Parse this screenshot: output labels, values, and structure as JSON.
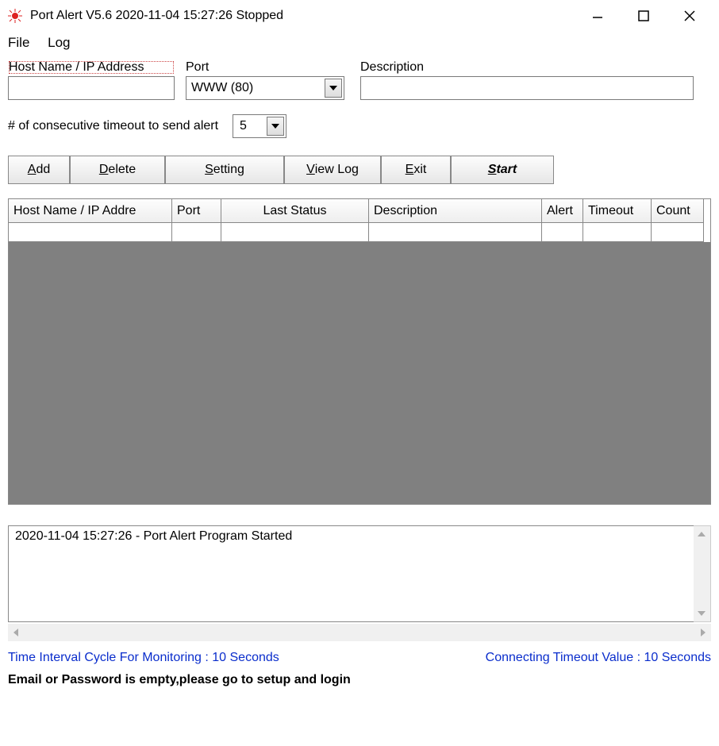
{
  "window": {
    "title": "Port Alert V5.6 2020-11-04 15:27:26 Stopped"
  },
  "menu": {
    "file": "File",
    "log": "Log"
  },
  "form": {
    "host_label": "Host Name / IP Address",
    "port_label": "Port",
    "desc_label": "Description",
    "host_value": "",
    "port_value": "WWW   (80)",
    "desc_value": "",
    "timeout_label": "# of consecutive timeout to send alert",
    "timeout_value": "5"
  },
  "buttons": {
    "add_pre": "",
    "add_u": "A",
    "add_post": "dd",
    "delete_pre": "",
    "delete_u": "D",
    "delete_post": "elete",
    "setting_pre": "",
    "setting_u": "S",
    "setting_post": "etting",
    "viewlog_pre": "",
    "viewlog_u": "V",
    "viewlog_post": "iew Log",
    "exit_pre": "",
    "exit_u": "E",
    "exit_post": "xit",
    "start_pre": "",
    "start_u": "S",
    "start_post": "tart"
  },
  "grid": {
    "headers": {
      "host": "Host Name / IP Addre",
      "port": "Port",
      "status": "Last Status",
      "desc": "Description",
      "alert": "Alert",
      "timeout": "Timeout",
      "count": "Count"
    }
  },
  "log": {
    "line1": "2020-11-04 15:27:26 - Port Alert Program Started"
  },
  "status": {
    "interval": "Time Interval Cycle For Monitoring : 10 Seconds",
    "timeout": "Connecting Timeout Value : 10 Seconds"
  },
  "warning": "Email or Password is empty,please go to setup and login"
}
